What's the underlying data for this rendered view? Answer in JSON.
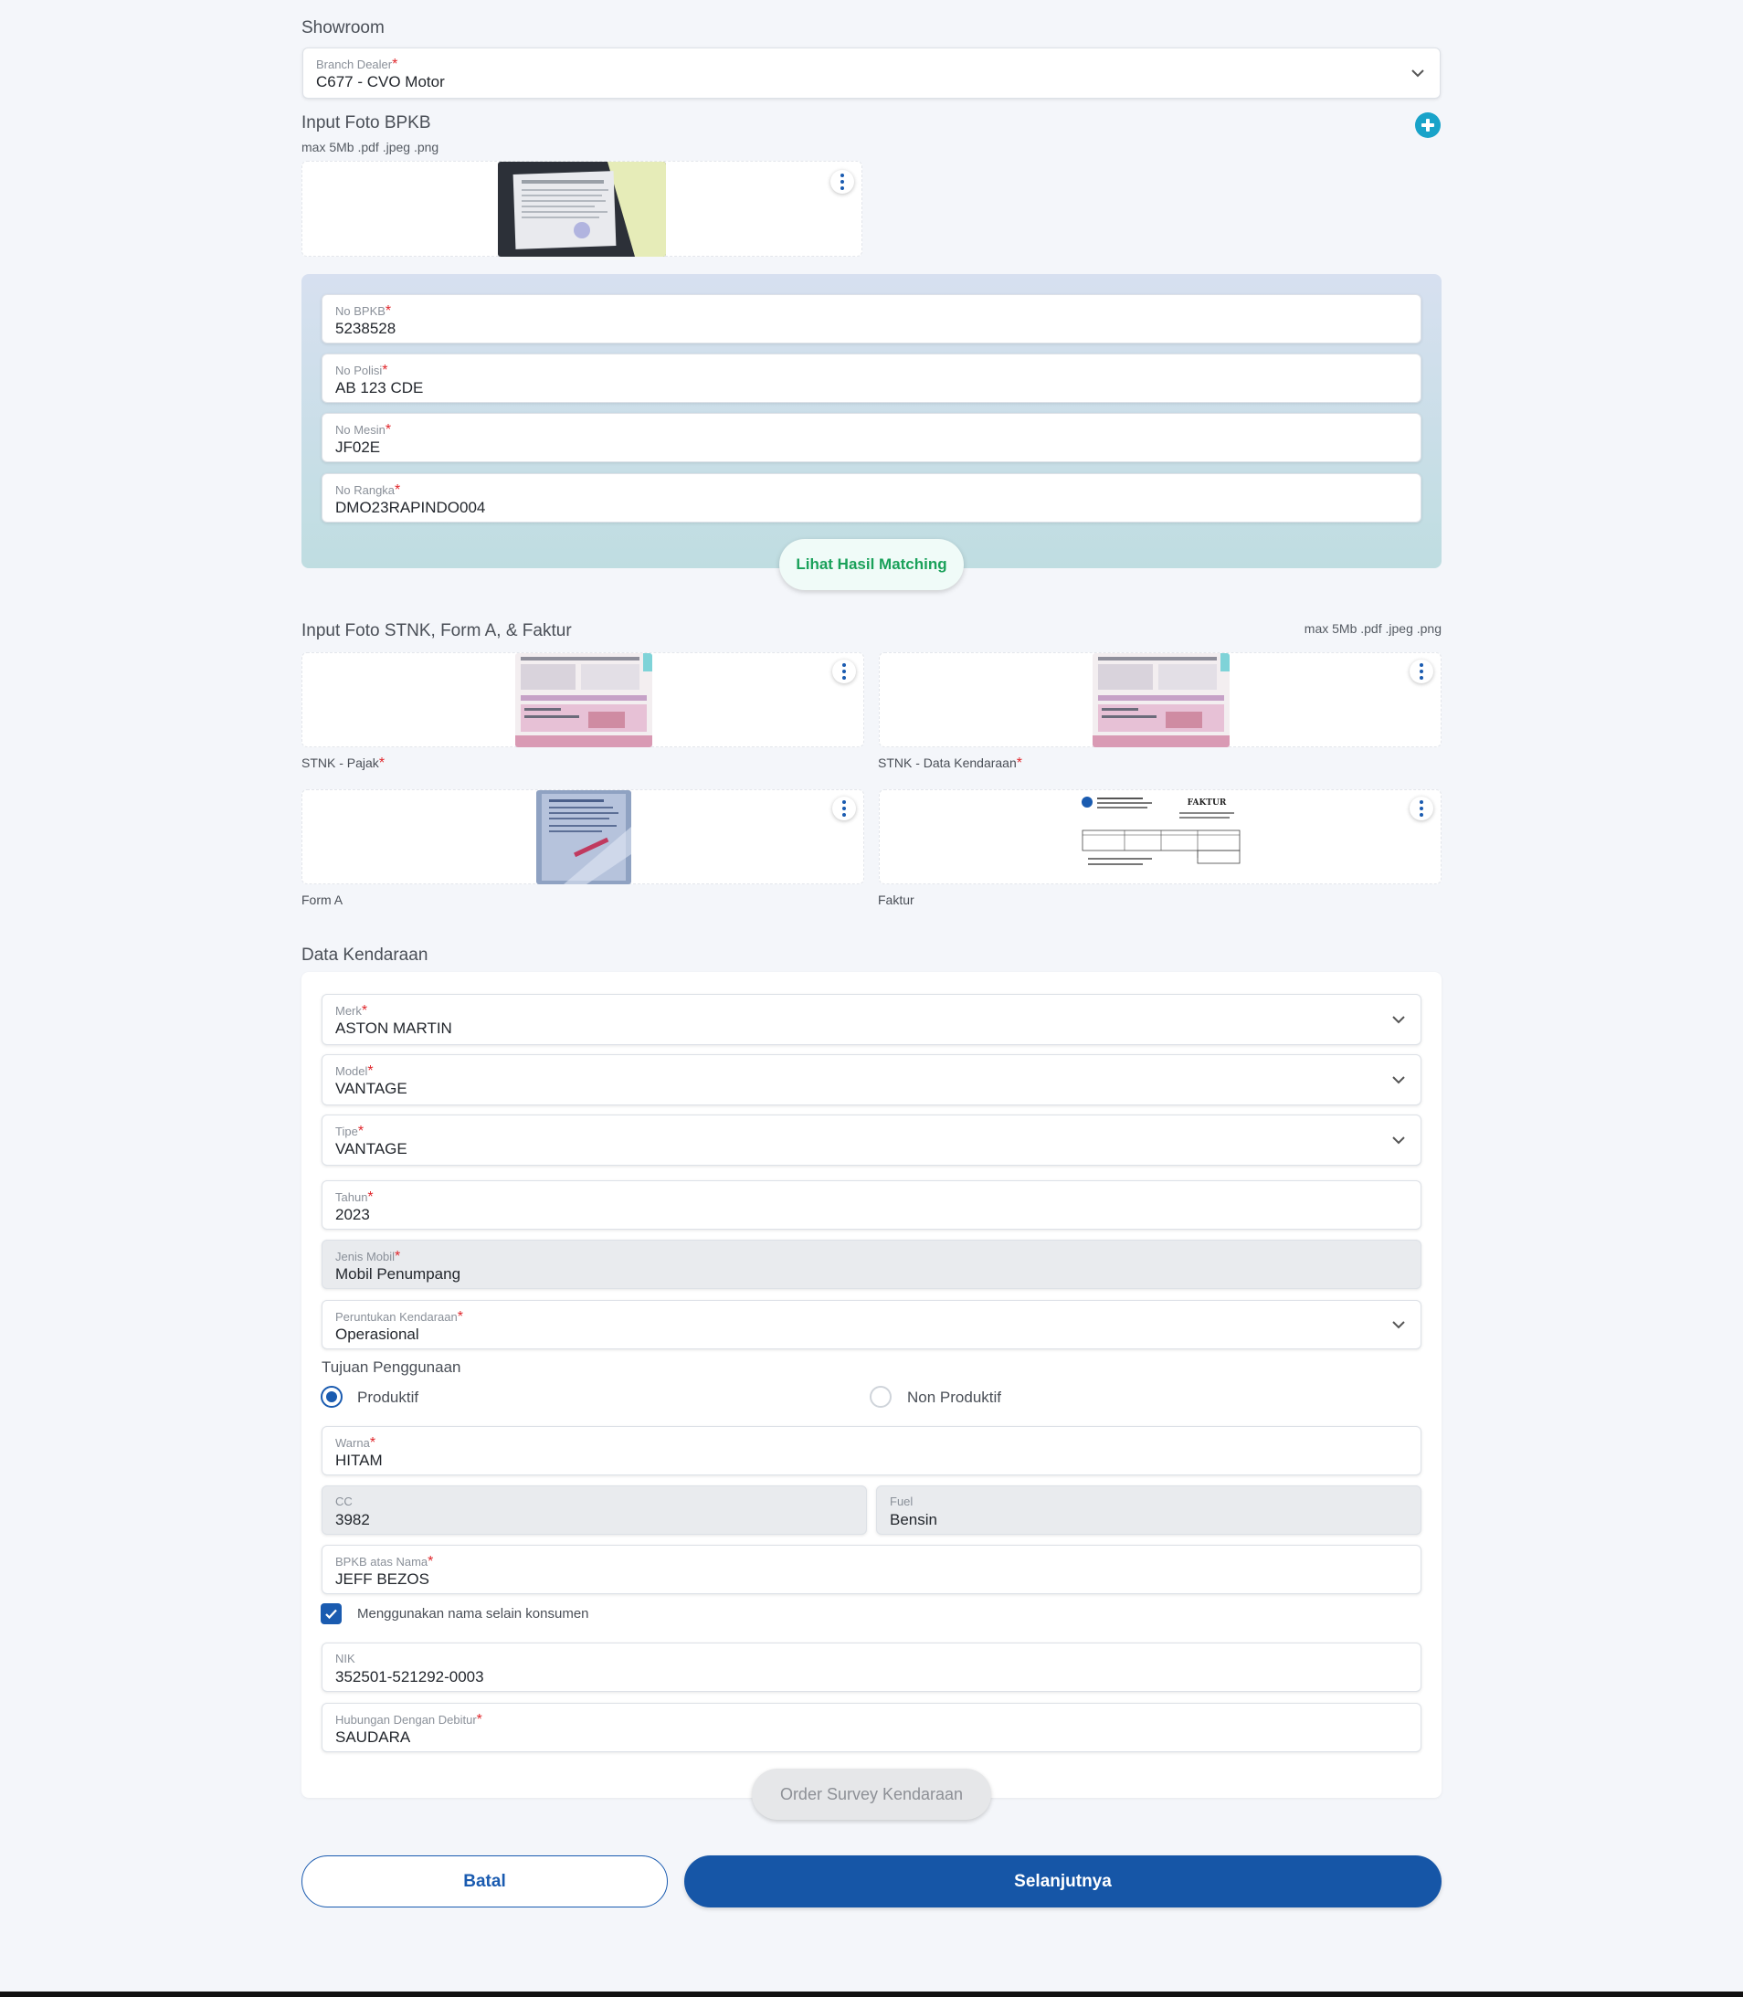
{
  "showroom": {
    "title": "Showroom",
    "branch_dealer": {
      "label": "Branch Dealer",
      "value": "C677 - CVO Motor"
    }
  },
  "bpkb_photo": {
    "title": "Input Foto BPKB",
    "hint": "max 5Mb .pdf .jpeg .png",
    "add_icon": "plus-circle-icon"
  },
  "bpkb_fields": {
    "no_bpkb": {
      "label": "No BPKB",
      "value": "5238528"
    },
    "no_polisi": {
      "label": "No Polisi",
      "value": "AB 123 CDE"
    },
    "no_mesin": {
      "label": "No Mesin",
      "value": "JF02E"
    },
    "no_rangka": {
      "label": "No Rangka",
      "value": "DMO23RAPINDO004"
    },
    "matching_button": "Lihat Hasil Matching"
  },
  "documents": {
    "title": "Input Foto STNK, Form A, & Faktur",
    "hint": "max 5Mb .pdf .jpeg .png",
    "items": [
      {
        "caption": "STNK - Pajak",
        "required": true
      },
      {
        "caption": "STNK - Data Kendaraan",
        "required": true
      },
      {
        "caption": "Form A",
        "required": false
      },
      {
        "caption": "Faktur",
        "required": false
      }
    ],
    "faktur_heading": "FAKTUR"
  },
  "vehicle": {
    "title": "Data Kendaraan",
    "merk": {
      "label": "Merk",
      "value": "ASTON MARTIN"
    },
    "model": {
      "label": "Model",
      "value": "VANTAGE"
    },
    "tipe": {
      "label": "Tipe",
      "value": "VANTAGE"
    },
    "tahun": {
      "label": "Tahun",
      "value": "2023"
    },
    "jenis_mobil": {
      "label": "Jenis Mobil",
      "value": "Mobil Penumpang"
    },
    "peruntukan": {
      "label": "Peruntukan Kendaraan",
      "value": "Operasional"
    },
    "tujuan": {
      "label": "Tujuan Penggunaan",
      "options": [
        "Produktif",
        "Non Produktif"
      ],
      "selected": "Produktif"
    },
    "warna": {
      "label": "Warna",
      "value": "HITAM"
    },
    "cc": {
      "label": "CC",
      "value": "3982"
    },
    "fuel": {
      "label": "Fuel",
      "value": "Bensin"
    },
    "bpkb_atas_nama": {
      "label": "BPKB atas Nama",
      "value": "JEFF BEZOS"
    },
    "use_other_name": {
      "label": "Menggunakan nama selain konsumen",
      "checked": true
    },
    "nik": {
      "label": "NIK",
      "value": "352501-521292-0003"
    },
    "hubungan": {
      "label": "Hubungan Dengan Debitur",
      "value": "SAUDARA"
    },
    "survey_button": "Order Survey Kendaraan"
  },
  "footer": {
    "cancel_label": "Batal",
    "next_label": "Selanjutnya"
  },
  "colors": {
    "primary": "#1656a7",
    "required": "#e0262b",
    "matching_text": "#1aa15a",
    "add_icon": "#19a3c9"
  }
}
